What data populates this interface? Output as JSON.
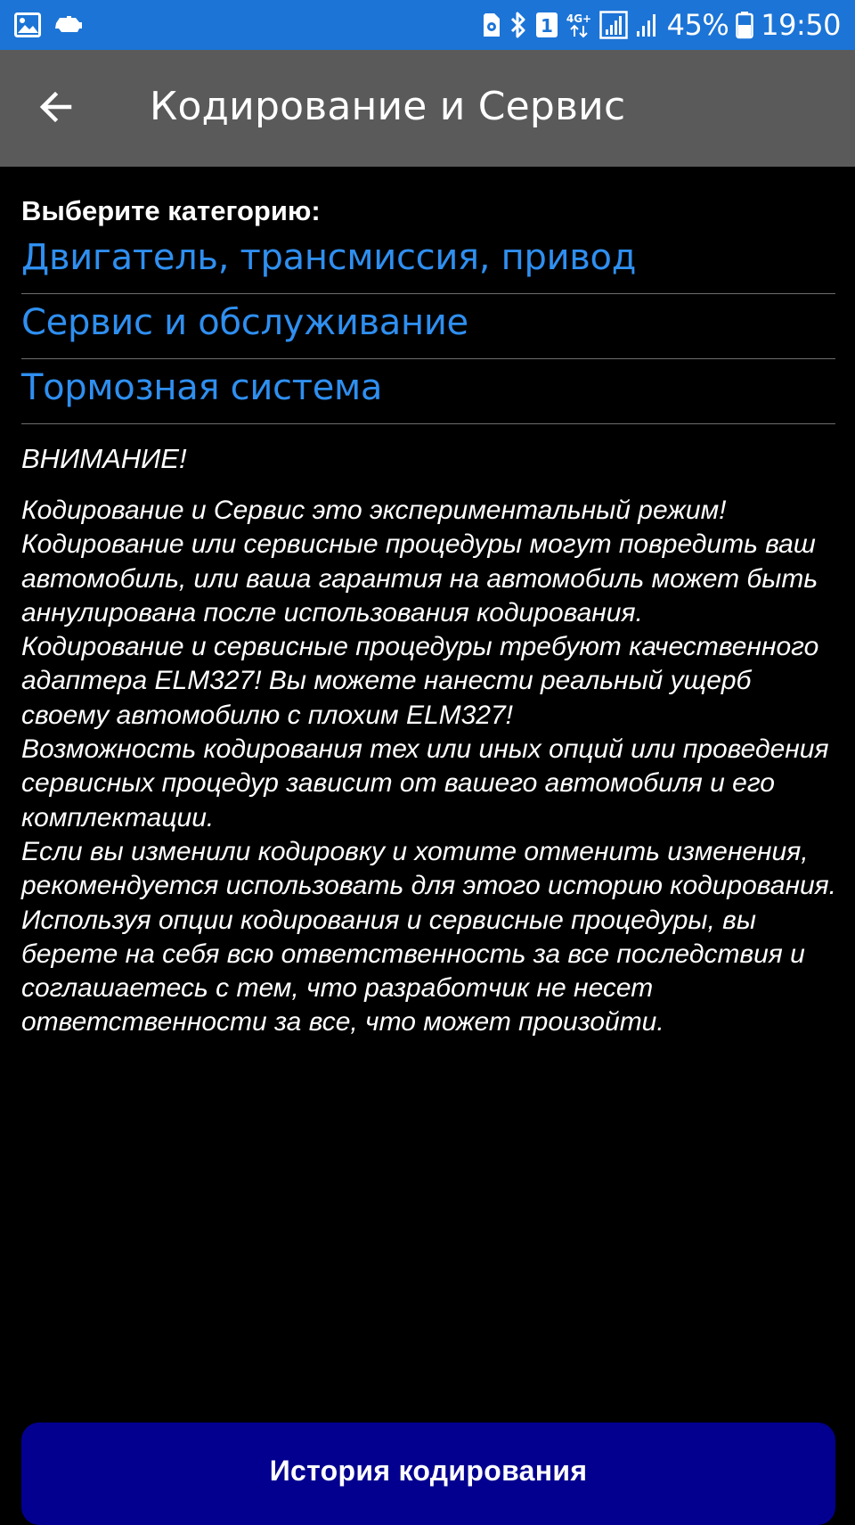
{
  "status_bar": {
    "left_icons": [
      "gallery-icon",
      "car-icon"
    ],
    "right_icons": [
      "storage-icon",
      "bluetooth-icon",
      "sim-icon",
      "network-4g-icon",
      "signal-icon",
      "signal-icon"
    ],
    "battery_percent": "45%",
    "time": "19:50",
    "background": "#1c74d6"
  },
  "app_bar": {
    "back_icon": "arrow-left-icon",
    "title": "Кодирование и Сервис",
    "background": "#5a5a5a"
  },
  "main": {
    "section_label": "Выберите категорию:",
    "categories": [
      {
        "label": "Двигатель, трансмиссия, привод"
      },
      {
        "label": "Сервис и обслуживание"
      },
      {
        "label": "Тормозная система"
      }
    ],
    "warning_title": "ВНИМАНИЕ!",
    "warning_text": "Кодирование и Сервис это экспериментальный режим!\nКодирование или сервисные процедуры могут повредить ваш автомобиль, или ваша гарантия на автомобиль может быть аннулирована после использования кодирования.\nКодирование и сервисные процедуры требуют качественного адаптера ELM327! Вы можете нанести реальный ущерб своему автомобилю с плохим ELM327!\nВозможность кодирования тех или иных опций или проведения сервисных процедур зависит от вашего автомобиля и его комплектации.\nЕсли вы изменили кодировку и хотите отменить изменения, рекомендуется использовать для этого историю кодирования.\nИспользуя опции кодирования и сервисные процедуры, вы берете на себя всю ответственность за все последствия и соглашаетесь с тем, что разработчик не несет ответственности за все, что может произойти."
  },
  "footer": {
    "history_button_label": "История кодирования",
    "button_color": "#03008f"
  },
  "colors": {
    "link": "#2f8ff0",
    "background": "#000000",
    "divider": "#6e6e6e"
  }
}
